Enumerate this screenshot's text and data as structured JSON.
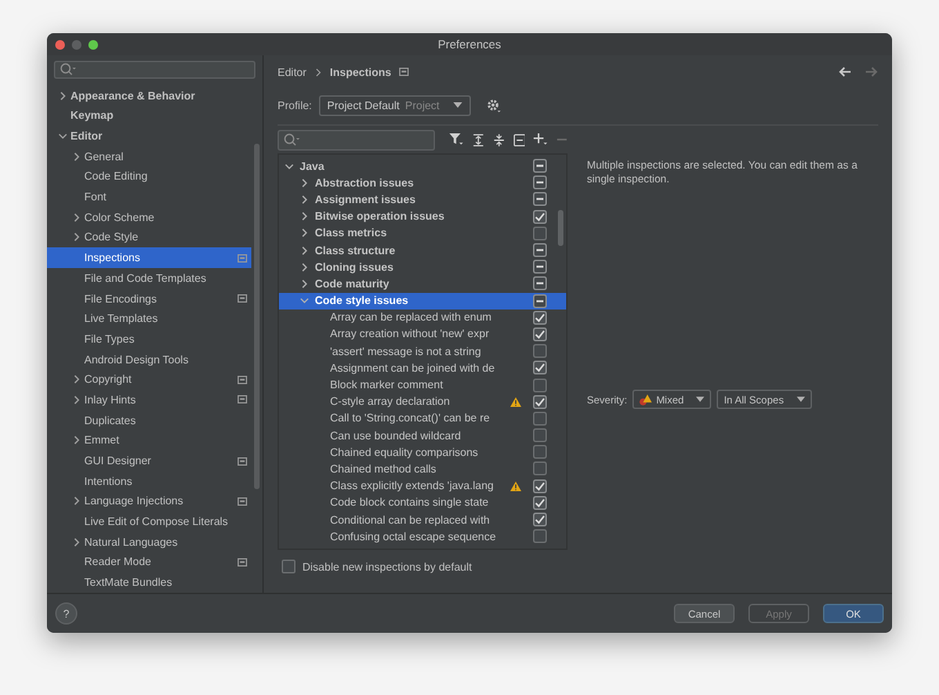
{
  "window": {
    "title": "Preferences"
  },
  "sidebar": {
    "items": [
      {
        "label": "Appearance & Behavior",
        "expanded": false,
        "selected": false
      },
      {
        "label": "Keymap",
        "selected": false
      },
      {
        "label": "Editor",
        "expanded": true,
        "selected": false,
        "children": [
          {
            "label": "General",
            "expanded": false,
            "selected": false
          },
          {
            "label": "Code Editing",
            "selected": false
          },
          {
            "label": "Font",
            "selected": false
          },
          {
            "label": "Color Scheme",
            "expanded": false,
            "selected": false
          },
          {
            "label": "Code Style",
            "expanded": false,
            "selected": false
          },
          {
            "label": "Inspections",
            "selected": true,
            "project_badge": true
          },
          {
            "label": "File and Code Templates",
            "selected": false
          },
          {
            "label": "File Encodings",
            "selected": false,
            "project_badge": true
          },
          {
            "label": "Live Templates",
            "selected": false
          },
          {
            "label": "File Types",
            "selected": false
          },
          {
            "label": "Android Design Tools",
            "selected": false
          },
          {
            "label": "Copyright",
            "expanded": false,
            "selected": false,
            "project_badge": true
          },
          {
            "label": "Inlay Hints",
            "expanded": false,
            "selected": false,
            "project_badge": true
          },
          {
            "label": "Duplicates",
            "selected": false
          },
          {
            "label": "Emmet",
            "expanded": false,
            "selected": false
          },
          {
            "label": "GUI Designer",
            "selected": false,
            "project_badge": true
          },
          {
            "label": "Intentions",
            "selected": false
          },
          {
            "label": "Language Injections",
            "expanded": false,
            "selected": false,
            "project_badge": true
          },
          {
            "label": "Live Edit of Compose Literals",
            "selected": false
          },
          {
            "label": "Natural Languages",
            "expanded": false,
            "selected": false
          },
          {
            "label": "Reader Mode",
            "selected": false,
            "project_badge": true
          },
          {
            "label": "TextMate Bundles",
            "selected": false
          }
        ]
      }
    ]
  },
  "breadcrumb": [
    "Editor",
    "Inspections"
  ],
  "profile": {
    "label": "Profile:",
    "value": "Project Default",
    "scope": "Project"
  },
  "inspections": [
    {
      "label": "Java",
      "expanded": true,
      "mixed": true,
      "selected": false,
      "children": [
        {
          "label": "Abstraction issues",
          "expanded": false,
          "mixed": true,
          "selected": false
        },
        {
          "label": "Assignment issues",
          "expanded": false,
          "mixed": true,
          "selected": false
        },
        {
          "label": "Bitwise operation issues",
          "expanded": false,
          "checked": true,
          "mixed": false,
          "selected": false
        },
        {
          "label": "Class metrics",
          "expanded": false,
          "checked": false,
          "mixed": false,
          "selected": false
        },
        {
          "label": "Class structure",
          "expanded": false,
          "mixed": true,
          "selected": false
        },
        {
          "label": "Cloning issues",
          "expanded": false,
          "mixed": true,
          "selected": false
        },
        {
          "label": "Code maturity",
          "expanded": false,
          "mixed": true,
          "selected": false
        },
        {
          "label": "Code style issues",
          "expanded": true,
          "mixed": true,
          "selected": true,
          "children": [
            {
              "label": "Array can be replaced with enum",
              "checked": true,
              "mixed": false,
              "selected": false
            },
            {
              "label": "Array creation without 'new' expr",
              "checked": true,
              "mixed": false,
              "selected": false
            },
            {
              "label": "'assert' message is not a string",
              "checked": false,
              "mixed": false,
              "selected": false
            },
            {
              "label": "Assignment can be joined with de",
              "checked": true,
              "mixed": false,
              "selected": false
            },
            {
              "label": "Block marker comment",
              "checked": false,
              "mixed": false,
              "selected": false
            },
            {
              "label": "C-style array declaration",
              "checked": true,
              "mixed": false,
              "warning": true,
              "selected": false
            },
            {
              "label": "Call to 'String.concat()' can be re",
              "checked": false,
              "mixed": false,
              "selected": false
            },
            {
              "label": "Can use bounded wildcard",
              "checked": false,
              "mixed": false,
              "selected": false
            },
            {
              "label": "Chained equality comparisons",
              "checked": false,
              "mixed": false,
              "selected": false
            },
            {
              "label": "Chained method calls",
              "checked": false,
              "mixed": false,
              "selected": false
            },
            {
              "label": "Class explicitly extends 'java.lang",
              "checked": true,
              "mixed": false,
              "warning": true,
              "selected": false
            },
            {
              "label": "Code block contains single state",
              "checked": true,
              "mixed": false,
              "selected": false
            },
            {
              "label": "Conditional can be replaced with",
              "checked": true,
              "mixed": false,
              "selected": false
            },
            {
              "label": "Confusing octal escape sequence",
              "checked": false,
              "mixed": false,
              "selected": false
            }
          ]
        }
      ]
    }
  ],
  "description": "Multiple inspections are selected. You can edit them as a single inspection.",
  "severity": {
    "label": "Severity:",
    "value": "Mixed",
    "scope": "In All Scopes"
  },
  "disable_new": {
    "label": "Disable new inspections by default",
    "checked": false
  },
  "help": "?",
  "buttons": [
    {
      "label": "Cancel",
      "kind": "default"
    },
    {
      "label": "Apply",
      "kind": "disabled"
    },
    {
      "label": "OK",
      "kind": "primary"
    }
  ]
}
